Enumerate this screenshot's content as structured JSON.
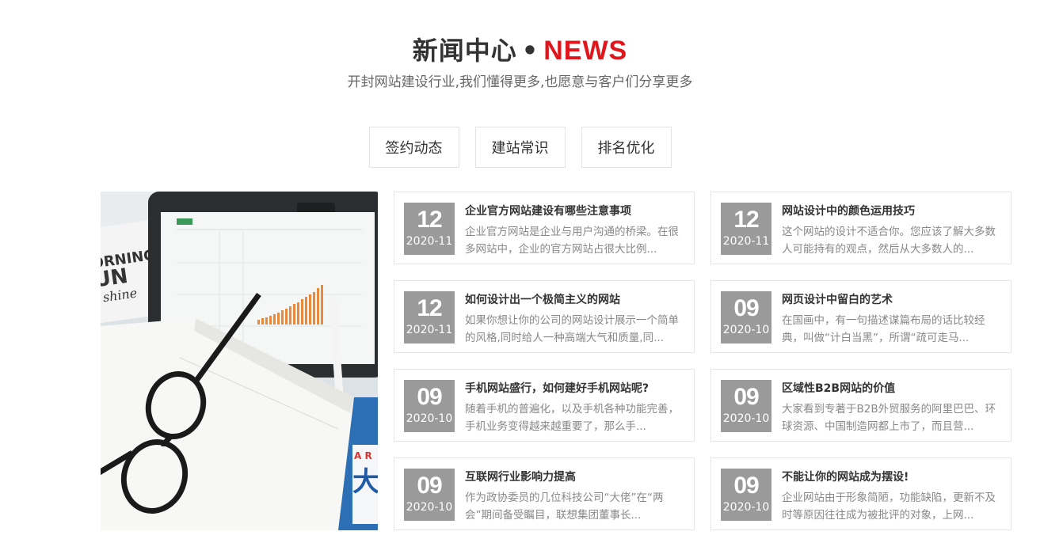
{
  "header": {
    "title_cn": "新闻中心",
    "title_dot": "•",
    "title_en": "NEWS",
    "subtitle": "开封网站建设行业,我们懂得更多,也愿意与客户们分享更多"
  },
  "tabs": [
    {
      "label": "签约动态"
    },
    {
      "label": "建站常识"
    },
    {
      "label": "排名优化"
    }
  ],
  "photo": {
    "book_text_1": "ORNING",
    "book_text_2": "UN",
    "book_text_3": "shine",
    "blue_text": "A  R",
    "blue_char": "大"
  },
  "news": [
    {
      "day": "12",
      "ym": "2020-11",
      "title": "企业官方网站建设有哪些注意事项",
      "desc": "企业官方网站是企业与用户沟通的桥梁。在很多网站中，企业的官方网站占很大比例..."
    },
    {
      "day": "12",
      "ym": "2020-11",
      "title": "网站设计中的颜色运用技巧",
      "desc": "这个网站的设计不适合你。您应该了解大多数人可能持有的观点，然后从大多数人的..."
    },
    {
      "day": "12",
      "ym": "2020-11",
      "title": "如何设计出一个极简主义的网站",
      "desc": "如果你想让你的公司的网站设计展示一个简单的风格,同时给人一种高端大气和质量,同..."
    },
    {
      "day": "09",
      "ym": "2020-10",
      "title": "网页设计中留白的艺术",
      "desc": "在国画中，有一句描述谋篇布局的话比较经典，叫做“计白当黑”，所谓“疏可走马..."
    },
    {
      "day": "09",
      "ym": "2020-10",
      "title": "手机网站盛行，如何建好手机网站呢?",
      "desc": "随着手机的普遍化，以及手机各种功能完善，手机业务变得越来越重要了，那么手..."
    },
    {
      "day": "09",
      "ym": "2020-10",
      "title": "区域性B2B网站的价值",
      "desc": "大家看到专著于B2B外贸服务的阿里巴巴、环球资源、中国制造网都上市了，而且营..."
    },
    {
      "day": "09",
      "ym": "2020-10",
      "title": "互联网行业影响力提高",
      "desc": "作为政协委员的几位科技公司“大佬”在“两会”期间备受瞩目，联想集团董事长..."
    },
    {
      "day": "09",
      "ym": "2020-10",
      "title": "不能让你的网站成为摆设!",
      "desc": "企业网站由于形象简陋，功能缺陷，更新不及时等原因往往成为被批评的对象，上网..."
    }
  ]
}
